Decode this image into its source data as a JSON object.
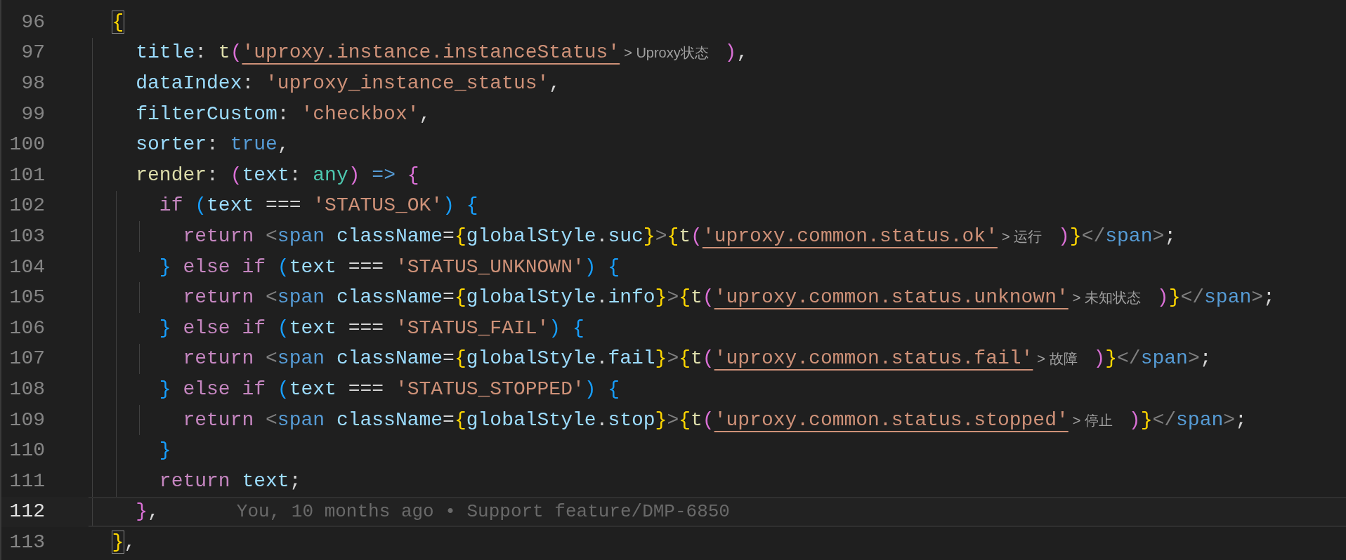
{
  "editor": {
    "lines": [
      {
        "number": "96",
        "current": false,
        "tokens": [
          {
            "text": "  {",
            "kind": "b1m"
          }
        ]
      },
      {
        "number": "97",
        "current": false,
        "tokens": [
          {
            "text": "    title",
            "kind": "prop"
          },
          {
            "text": ": ",
            "kind": "p"
          },
          {
            "text": "t",
            "kind": "fn"
          },
          {
            "text": "(",
            "kind": "b2"
          },
          {
            "text": "'uproxy.instance.instanceStatus'",
            "kind": "key"
          },
          {
            "text": "> Uproxy状态",
            "kind": "hint"
          },
          {
            "text": " )",
            "kind": "b2"
          },
          {
            "text": ",",
            "kind": "p"
          }
        ]
      },
      {
        "number": "98",
        "current": false,
        "tokens": [
          {
            "text": "    dataIndex",
            "kind": "prop"
          },
          {
            "text": ": ",
            "kind": "p"
          },
          {
            "text": "'uproxy_instance_status'",
            "kind": "str"
          },
          {
            "text": ",",
            "kind": "p"
          }
        ]
      },
      {
        "number": "99",
        "current": false,
        "tokens": [
          {
            "text": "    filterCustom",
            "kind": "prop"
          },
          {
            "text": ": ",
            "kind": "p"
          },
          {
            "text": "'checkbox'",
            "kind": "str"
          },
          {
            "text": ",",
            "kind": "p"
          }
        ]
      },
      {
        "number": "100",
        "current": false,
        "tokens": [
          {
            "text": "    sorter",
            "kind": "prop"
          },
          {
            "text": ": ",
            "kind": "p"
          },
          {
            "text": "true",
            "kind": "bool"
          },
          {
            "text": ",",
            "kind": "p"
          }
        ]
      },
      {
        "number": "101",
        "current": false,
        "tokens": [
          {
            "text": "    render",
            "kind": "fn"
          },
          {
            "text": ": ",
            "kind": "p"
          },
          {
            "text": "(",
            "kind": "b2"
          },
          {
            "text": "text",
            "kind": "prop"
          },
          {
            "text": ": ",
            "kind": "p"
          },
          {
            "text": "any",
            "kind": "type"
          },
          {
            "text": ") ",
            "kind": "b2"
          },
          {
            "text": "=> ",
            "kind": "bool"
          },
          {
            "text": "{",
            "kind": "b2"
          }
        ]
      },
      {
        "number": "102",
        "current": false,
        "tokens": [
          {
            "text": "      if ",
            "kind": "kw"
          },
          {
            "text": "(",
            "kind": "b3"
          },
          {
            "text": "text",
            "kind": "prop"
          },
          {
            "text": " === ",
            "kind": "p"
          },
          {
            "text": "'STATUS_OK'",
            "kind": "str"
          },
          {
            "text": ") {",
            "kind": "b3"
          }
        ]
      },
      {
        "number": "103",
        "current": false,
        "tokens": [
          {
            "text": "        return ",
            "kind": "kw"
          },
          {
            "text": "<",
            "kind": "ang"
          },
          {
            "text": "span ",
            "kind": "tag"
          },
          {
            "text": "className",
            "kind": "prop"
          },
          {
            "text": "=",
            "kind": "p"
          },
          {
            "text": "{",
            "kind": "b1"
          },
          {
            "text": "globalStyle",
            "kind": "prop"
          },
          {
            "text": ".",
            "kind": "p"
          },
          {
            "text": "suc",
            "kind": "prop"
          },
          {
            "text": "}",
            "kind": "b1"
          },
          {
            "text": ">",
            "kind": "ang"
          },
          {
            "text": "{",
            "kind": "b1"
          },
          {
            "text": "t",
            "kind": "fn"
          },
          {
            "text": "(",
            "kind": "b2"
          },
          {
            "text": "'uproxy.common.status.ok'",
            "kind": "key"
          },
          {
            "text": "> 运行",
            "kind": "hint"
          },
          {
            "text": " )",
            "kind": "b2"
          },
          {
            "text": "}",
            "kind": "b1"
          },
          {
            "text": "</",
            "kind": "ang"
          },
          {
            "text": "span",
            "kind": "tag"
          },
          {
            "text": ">",
            "kind": "ang"
          },
          {
            "text": ";",
            "kind": "p"
          }
        ]
      },
      {
        "number": "104",
        "current": false,
        "tokens": [
          {
            "text": "      } ",
            "kind": "b3"
          },
          {
            "text": "else if ",
            "kind": "kw"
          },
          {
            "text": "(",
            "kind": "b3"
          },
          {
            "text": "text",
            "kind": "prop"
          },
          {
            "text": " === ",
            "kind": "p"
          },
          {
            "text": "'STATUS_UNKNOWN'",
            "kind": "str"
          },
          {
            "text": ") {",
            "kind": "b3"
          }
        ]
      },
      {
        "number": "105",
        "current": false,
        "tokens": [
          {
            "text": "        return ",
            "kind": "kw"
          },
          {
            "text": "<",
            "kind": "ang"
          },
          {
            "text": "span ",
            "kind": "tag"
          },
          {
            "text": "className",
            "kind": "prop"
          },
          {
            "text": "=",
            "kind": "p"
          },
          {
            "text": "{",
            "kind": "b1"
          },
          {
            "text": "globalStyle",
            "kind": "prop"
          },
          {
            "text": ".",
            "kind": "p"
          },
          {
            "text": "info",
            "kind": "prop"
          },
          {
            "text": "}",
            "kind": "b1"
          },
          {
            "text": ">",
            "kind": "ang"
          },
          {
            "text": "{",
            "kind": "b1"
          },
          {
            "text": "t",
            "kind": "fn"
          },
          {
            "text": "(",
            "kind": "b2"
          },
          {
            "text": "'uproxy.common.status.unknown'",
            "kind": "key"
          },
          {
            "text": "> 未知状态",
            "kind": "hint"
          },
          {
            "text": " )",
            "kind": "b2"
          },
          {
            "text": "}",
            "kind": "b1"
          },
          {
            "text": "</",
            "kind": "ang"
          },
          {
            "text": "span",
            "kind": "tag"
          },
          {
            "text": ">",
            "kind": "ang"
          },
          {
            "text": ";",
            "kind": "p"
          }
        ]
      },
      {
        "number": "106",
        "current": false,
        "tokens": [
          {
            "text": "      } ",
            "kind": "b3"
          },
          {
            "text": "else if ",
            "kind": "kw"
          },
          {
            "text": "(",
            "kind": "b3"
          },
          {
            "text": "text",
            "kind": "prop"
          },
          {
            "text": " === ",
            "kind": "p"
          },
          {
            "text": "'STATUS_FAIL'",
            "kind": "str"
          },
          {
            "text": ") {",
            "kind": "b3"
          }
        ]
      },
      {
        "number": "107",
        "current": false,
        "tokens": [
          {
            "text": "        return ",
            "kind": "kw"
          },
          {
            "text": "<",
            "kind": "ang"
          },
          {
            "text": "span ",
            "kind": "tag"
          },
          {
            "text": "className",
            "kind": "prop"
          },
          {
            "text": "=",
            "kind": "p"
          },
          {
            "text": "{",
            "kind": "b1"
          },
          {
            "text": "globalStyle",
            "kind": "prop"
          },
          {
            "text": ".",
            "kind": "p"
          },
          {
            "text": "fail",
            "kind": "prop"
          },
          {
            "text": "}",
            "kind": "b1"
          },
          {
            "text": ">",
            "kind": "ang"
          },
          {
            "text": "{",
            "kind": "b1"
          },
          {
            "text": "t",
            "kind": "fn"
          },
          {
            "text": "(",
            "kind": "b2"
          },
          {
            "text": "'uproxy.common.status.fail'",
            "kind": "key"
          },
          {
            "text": "> 故障",
            "kind": "hint"
          },
          {
            "text": " )",
            "kind": "b2"
          },
          {
            "text": "}",
            "kind": "b1"
          },
          {
            "text": "</",
            "kind": "ang"
          },
          {
            "text": "span",
            "kind": "tag"
          },
          {
            "text": ">",
            "kind": "ang"
          },
          {
            "text": ";",
            "kind": "p"
          }
        ]
      },
      {
        "number": "108",
        "current": false,
        "tokens": [
          {
            "text": "      } ",
            "kind": "b3"
          },
          {
            "text": "else if ",
            "kind": "kw"
          },
          {
            "text": "(",
            "kind": "b3"
          },
          {
            "text": "text",
            "kind": "prop"
          },
          {
            "text": " === ",
            "kind": "p"
          },
          {
            "text": "'STATUS_STOPPED'",
            "kind": "str"
          },
          {
            "text": ") {",
            "kind": "b3"
          }
        ]
      },
      {
        "number": "109",
        "current": false,
        "tokens": [
          {
            "text": "        return ",
            "kind": "kw"
          },
          {
            "text": "<",
            "kind": "ang"
          },
          {
            "text": "span ",
            "kind": "tag"
          },
          {
            "text": "className",
            "kind": "prop"
          },
          {
            "text": "=",
            "kind": "p"
          },
          {
            "text": "{",
            "kind": "b1"
          },
          {
            "text": "globalStyle",
            "kind": "prop"
          },
          {
            "text": ".",
            "kind": "p"
          },
          {
            "text": "stop",
            "kind": "prop"
          },
          {
            "text": "}",
            "kind": "b1"
          },
          {
            "text": ">",
            "kind": "ang"
          },
          {
            "text": "{",
            "kind": "b1"
          },
          {
            "text": "t",
            "kind": "fn"
          },
          {
            "text": "(",
            "kind": "b2"
          },
          {
            "text": "'uproxy.common.status.stopped'",
            "kind": "key"
          },
          {
            "text": "> 停止",
            "kind": "hint"
          },
          {
            "text": " )",
            "kind": "b2"
          },
          {
            "text": "}",
            "kind": "b1"
          },
          {
            "text": "</",
            "kind": "ang"
          },
          {
            "text": "span",
            "kind": "tag"
          },
          {
            "text": ">",
            "kind": "ang"
          },
          {
            "text": ";",
            "kind": "p"
          }
        ]
      },
      {
        "number": "110",
        "current": false,
        "tokens": [
          {
            "text": "      }",
            "kind": "b3"
          }
        ]
      },
      {
        "number": "111",
        "current": false,
        "tokens": [
          {
            "text": "      return ",
            "kind": "kw"
          },
          {
            "text": "text",
            "kind": "prop"
          },
          {
            "text": ";",
            "kind": "p"
          }
        ]
      },
      {
        "number": "112",
        "current": true,
        "blame": "You, 10 months ago • Support feature/DMP-6850",
        "tokens": [
          {
            "text": "    }",
            "kind": "b2"
          },
          {
            "text": ",",
            "kind": "p"
          }
        ]
      },
      {
        "number": "113",
        "current": false,
        "tokens": [
          {
            "text": "  }",
            "kind": "b1m"
          },
          {
            "text": ",",
            "kind": "p"
          }
        ]
      }
    ]
  }
}
